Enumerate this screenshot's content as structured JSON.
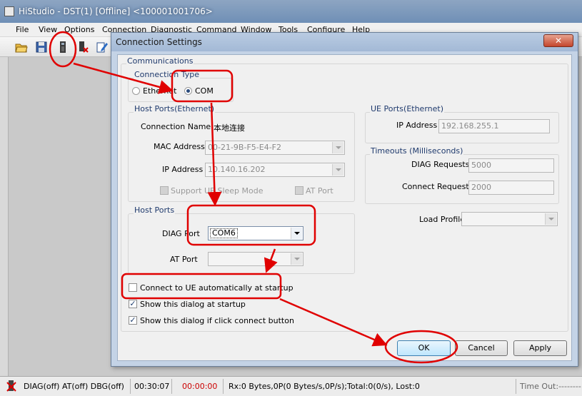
{
  "main_window": {
    "title": "HiStudio - DST(1) [Offline] <100001001706>",
    "menu": [
      "File",
      "View",
      "Options",
      "Connection",
      "Diagnostic",
      "Command",
      "Window",
      "Tools",
      "Configure",
      "Help"
    ],
    "toolbar_icons": [
      "open-folder-icon",
      "save-icon",
      "connect-icon",
      "disconnect-icon",
      "edit-icon"
    ]
  },
  "dialog": {
    "title": "Connection Settings",
    "close_label": "✕",
    "communications": {
      "label": "Communications",
      "connection_type": {
        "label": "Connection Type",
        "options": [
          "Ethernet",
          "COM"
        ],
        "selected": "COM"
      }
    },
    "host_ports_ethernet": {
      "label": "Host Ports(Ethernet)",
      "connection_name_label": "Connection Name",
      "connection_name_value": "本地连接",
      "mac_label": "MAC Address",
      "mac_value": "00-21-9B-F5-E4-F2",
      "ip_label": "IP Address",
      "ip_value": "10.140.16.202",
      "support_sleep_label": "Support UE Sleep Mode",
      "at_port_label": "AT Port"
    },
    "ue_ports": {
      "label": "UE Ports(Ethernet)",
      "ip_label": "IP Address",
      "ip_value": "192.168.255.1"
    },
    "timeouts": {
      "label": "Timeouts (Milliseconds)",
      "diag_label": "DIAG Requests",
      "diag_value": "5000",
      "connect_label": "Connect Requests",
      "connect_value": "2000"
    },
    "host_ports": {
      "label": "Host Ports",
      "diag_port_label": "DIAG Port",
      "diag_port_value": "COM6",
      "at_port_label": "AT Port",
      "at_port_value": ""
    },
    "load_profile_label": "Load Profile",
    "load_profile_value": "",
    "options": {
      "auto_connect_label": "Connect to UE automatically at startup",
      "auto_connect_checked": false,
      "show_startup_label": "Show this dialog at startup",
      "show_startup_checked": true,
      "show_connect_label": "Show this dialog if click connect button",
      "show_connect_checked": true
    },
    "buttons": {
      "ok": "OK",
      "cancel": "Cancel",
      "apply": "Apply"
    }
  },
  "statusbar": {
    "ports": "DIAG(off) AT(off) DBG(off)",
    "elapsed": "00:30:07",
    "timer": "00:00:00",
    "traffic": "Rx:0 Bytes,0P(0 Bytes/s,0P/s);Total:0(0/s), Lost:0",
    "timeout": "Time Out:--------"
  },
  "colors": {
    "annotation": "#e00000",
    "timer_text": "#cc0000",
    "dialog_frame": "#c4d3e6"
  }
}
